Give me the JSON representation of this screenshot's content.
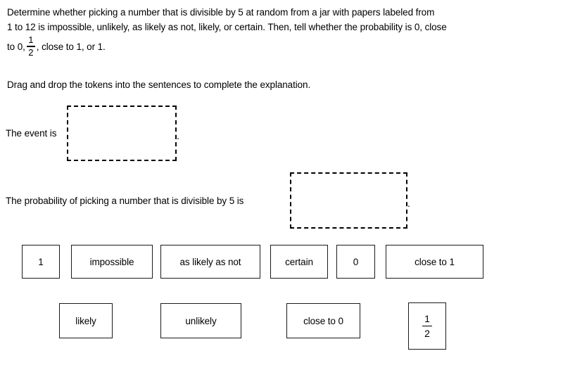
{
  "prompt": {
    "line1": "Determine whether picking a number that is divisible by 5 at random from a jar with papers labeled from",
    "line2": "1 to 12 is impossible, unlikely, as likely as not, likely, or certain. Then, tell whether the probability is 0, close",
    "line3_before": "to 0,",
    "line3_fraction_numerator": "1",
    "line3_fraction_denominator": "2",
    "line3_after": ", close to 1, or 1."
  },
  "instruction": "Drag and drop the tokens into the sentences to complete the explanation.",
  "sentences": [
    {
      "label": "The event is",
      "dropzone_value": "",
      "terminator": "."
    },
    {
      "label": "The probability of picking a number that is divisible by 5 is",
      "dropzone_value": "",
      "terminator": "."
    }
  ],
  "tokens": {
    "row1": [
      {
        "label": "1"
      },
      {
        "label": "impossible"
      },
      {
        "label": "as likely as not"
      },
      {
        "label": "certain"
      },
      {
        "label": "0"
      },
      {
        "label": "close to 1"
      }
    ],
    "row2": [
      {
        "label": "likely"
      },
      {
        "label": "unlikely"
      },
      {
        "label": "close to 0"
      },
      {
        "label": "",
        "numerator": "1",
        "denominator": "2"
      }
    ]
  },
  "colors": {
    "text": "#000000",
    "background": "#ffffff",
    "token_border": "#1a1a1a",
    "dropzone_border": "#000000"
  }
}
